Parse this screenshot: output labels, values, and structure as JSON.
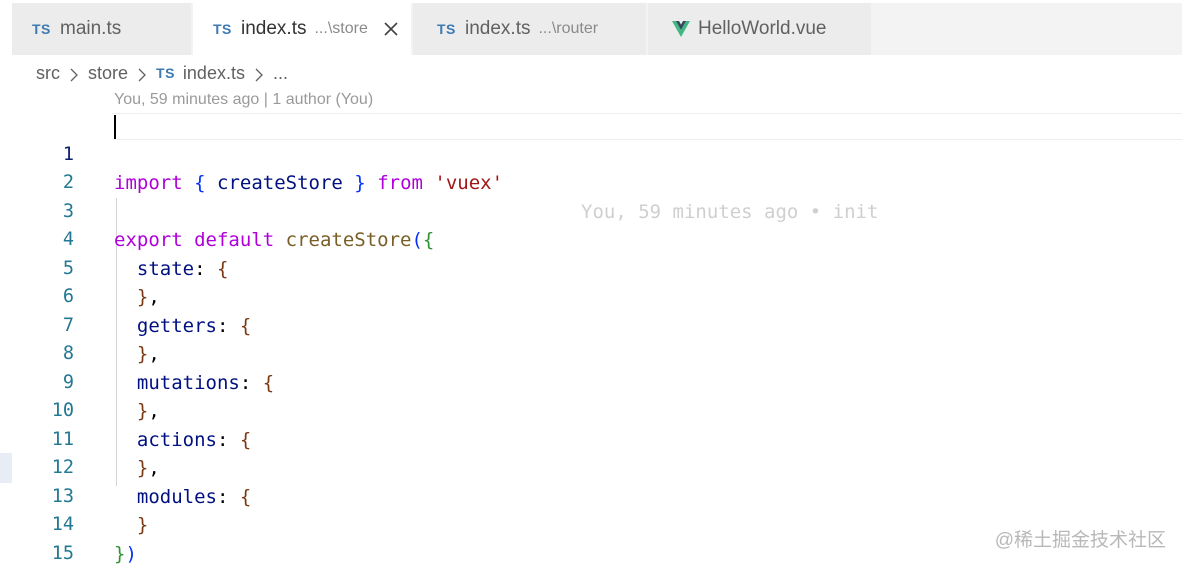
{
  "tabs": [
    {
      "icon": "TS",
      "name": "main.ts",
      "desc": "",
      "active": false
    },
    {
      "icon": "TS",
      "name": "index.ts",
      "desc": "...\\store",
      "active": true
    },
    {
      "icon": "TS",
      "name": "index.ts",
      "desc": "...\\router",
      "active": false
    },
    {
      "icon": "vue-icon",
      "name": "HelloWorld.vue",
      "desc": "",
      "active": false
    }
  ],
  "breadcrumb": {
    "items": [
      "src",
      "store",
      "index.ts",
      "..."
    ],
    "file_icon": "TS"
  },
  "blame_header": "You, 59 minutes ago | 1 author (You)",
  "editor": {
    "line_numbers": [
      "1",
      "2",
      "3",
      "4",
      "5",
      "6",
      "7",
      "8",
      "9",
      "10",
      "11",
      "12",
      "13",
      "14",
      "15"
    ],
    "current_line": 1,
    "inline_blame": "You, 59 minutes ago • init",
    "code": {
      "l1": {
        "import": "import",
        "open": "{",
        "name": "createStore",
        "close": "}",
        "from": "from",
        "str": "'vuex'"
      },
      "l3": {
        "export": "export",
        "default": "default",
        "fn": "createStore",
        "open_paren": "(",
        "open_brace": "{"
      },
      "props": [
        {
          "key": "state",
          "colon": ":",
          "open": "{",
          "close": "}",
          "comma": ","
        },
        {
          "key": "getters",
          "colon": ":",
          "open": "{",
          "close": "}",
          "comma": ","
        },
        {
          "key": "mutations",
          "colon": ":",
          "open": "{",
          "close": "}",
          "comma": ","
        },
        {
          "key": "actions",
          "colon": ":",
          "open": "{",
          "close": "}",
          "comma": ","
        },
        {
          "key": "modules",
          "colon": ":",
          "open": "{",
          "close": "}",
          "comma": ""
        }
      ],
      "l14": {
        "close_brace": "}",
        "close_paren": ")"
      }
    }
  },
  "watermark": "@稀土掘金技术社区",
  "colors": {
    "ts_icon": "#3c7ab1",
    "vue_icon": "#41b883",
    "line_number": "#237893",
    "keyword_control": "#af00db",
    "keyword": "#0000ff",
    "function": "#795e26",
    "variable": "#001080",
    "string": "#a31515"
  }
}
